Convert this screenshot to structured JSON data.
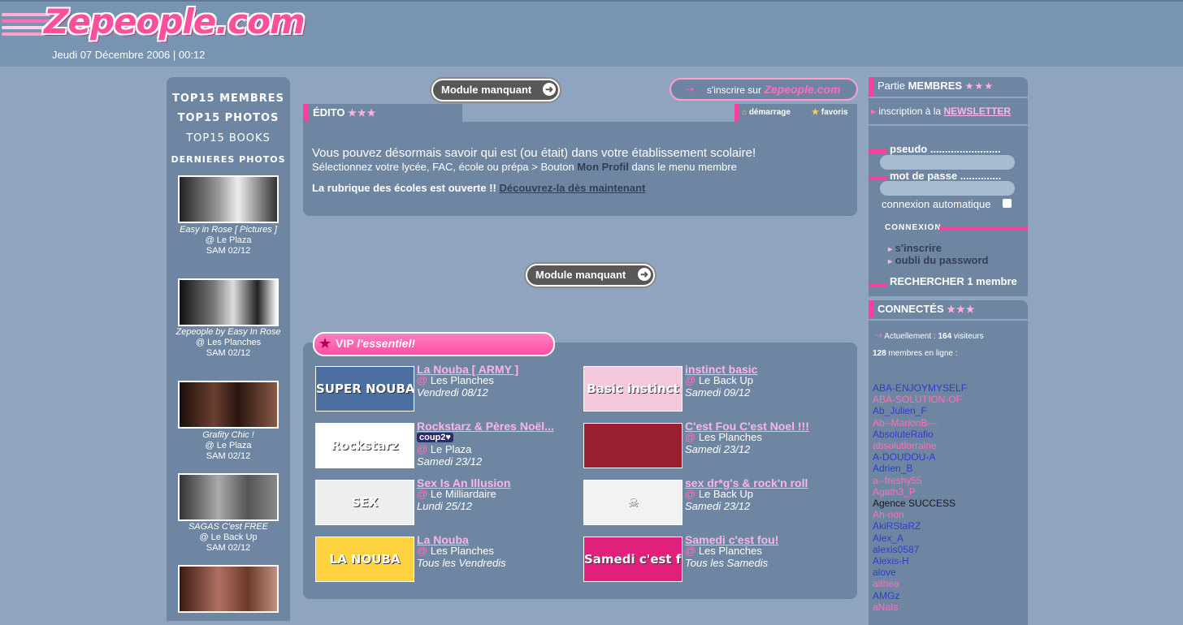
{
  "site": {
    "logo": "Zepeople.com",
    "date": "Jeudi 07 Décembre 2006 | 00:12"
  },
  "left_nav": {
    "top15_members": "TOP15 MEMBRES",
    "top15_photos": "TOP15 PHOTOS",
    "top15_books": "TOP15 BOOKS",
    "last_photos": "DERNIERES PHOTOS",
    "photos": [
      {
        "title": "Easy in Rose [ Pictures ]",
        "place": "@ Le Plaza",
        "date": "SAM 02/12"
      },
      {
        "title": "Zepeople by Easy In Rose",
        "place": "@ Les Planches",
        "date": "SAM 02/12"
      },
      {
        "title": "Grafity Chic !",
        "place": "@ Le Plaza",
        "date": "SAM 02/12"
      },
      {
        "title": "SAGAS C'est FREE",
        "place": "@ Le Back Up",
        "date": "SAM 02/12"
      }
    ]
  },
  "center": {
    "module_missing": "Module manquant",
    "inscrire_prefix": "s'inscrire sur",
    "inscrire_brand": "Zepeople.com",
    "edito_title": "ÉDITO",
    "stars": "★★★",
    "demarrage": "démarrage",
    "favoris": "favoris",
    "edito_line1": "Vous pouvez désormais savoir qui est (ou était) dans votre établissement scolaire!",
    "edito_line2_a": "Sélectionnez votre lycée, FAC, école ou prépa > Bouton",
    "edito_line2_b": "Mon Profil",
    "edito_line2_c": "dans le menu membre",
    "edito_line3_a": "La rubrique des écoles est ouverte !!",
    "edito_line3_b": "Découvrez-la dès maintenant",
    "vip_label": "VIP",
    "vip_tagline": "l'essentiel!",
    "events": [
      {
        "title": "La Nouba [ ARMY ]",
        "extra": "",
        "place": "Les Planches",
        "date": "Vendredi 08/12",
        "img_text": "SUPER NOUBA",
        "img_bg": "#4b6fa0"
      },
      {
        "title": "instinct basic",
        "extra": "",
        "place": "Le Back Up",
        "date": "Samedi 09/12",
        "img_text": "Basic instinct",
        "img_bg": "#f3c8dd"
      },
      {
        "title": "Rockstarz & Pères Noël...",
        "extra": "coup2♥",
        "place": "Le Plaza",
        "date": "Samedi 23/12",
        "img_text": "Rockstarz",
        "img_bg": "#ffffff"
      },
      {
        "title": "C'est Fou C'est Noel !!!",
        "extra": "",
        "place": "Les Planches",
        "date": "Samedi 23/12",
        "img_text": "",
        "img_bg": "#9a2030"
      },
      {
        "title": "Sex Is An Illusion",
        "extra": "",
        "place": "Le Milliardaire",
        "date": "Lundi 25/12",
        "img_text": "SEX",
        "img_bg": "#eeeeee"
      },
      {
        "title": "sex dr*g's & rock'n roll",
        "extra": "",
        "place": "Le Back Up",
        "date": "Samedi 23/12",
        "img_text": "☠",
        "img_bg": "#f2f2f2"
      },
      {
        "title": "La Nouba",
        "extra": "",
        "place": "Les Planches",
        "date": "Tous les Vendredis",
        "img_text": "LA NOUBA",
        "img_bg": "#ffd23f"
      },
      {
        "title": "Samedi c'est fou!",
        "extra": "",
        "place": "Les Planches",
        "date": "Tous les Samedis",
        "img_text": "Samedi c'est fou !",
        "img_bg": "#e0207a"
      }
    ]
  },
  "right_panel": {
    "partie_prefix": "Partie",
    "partie_bold": "MEMBRES",
    "newsletter_prefix": "inscription à la",
    "newsletter_link": "NEWSLETTER",
    "pseudo_label": "pseudo ........................",
    "password_label": "mot de passe ..............",
    "auto_login": "connexion automatique",
    "connexion": "CONNEXION",
    "register": "s'inscrire",
    "forgot": "oubli du password",
    "search_member": "RECHERCHER 1 membre",
    "connected_title": "CONNECTÉS",
    "visitors_prefix": "Actuellement :",
    "visitors_count": "164",
    "visitors_suffix": "visiteurs",
    "online_count": "128",
    "online_suffix": "membres en ligne :",
    "members": [
      {
        "name": "ABA-ENJOYMYSELF",
        "color": "#2a3fcf"
      },
      {
        "name": "ABA-SOLUTION-OF",
        "color": "#ff6fb7"
      },
      {
        "name": "Ab_Julien_F",
        "color": "#2a3fcf"
      },
      {
        "name": "Ab--MarionB---",
        "color": "#ff6fb7"
      },
      {
        "name": "AbsoluteRafio",
        "color": "#2a3fcf"
      },
      {
        "name": "absolutlorraine",
        "color": "#ff6fb7"
      },
      {
        "name": "A-DOUDOU-A",
        "color": "#2a3fcf"
      },
      {
        "name": "Adrien_B",
        "color": "#2a3fcf"
      },
      {
        "name": "a--freshy55",
        "color": "#ff6fb7"
      },
      {
        "name": "Agath3_P",
        "color": "#ff6fb7"
      },
      {
        "name": "Agence SUCCESS",
        "color": "#1a1a1a"
      },
      {
        "name": "Ah-non",
        "color": "#ff6fb7"
      },
      {
        "name": "AkiRStaRZ",
        "color": "#2a3fcf"
      },
      {
        "name": "Alex_A",
        "color": "#2a3fcf"
      },
      {
        "name": "alexis0587",
        "color": "#2a3fcf"
      },
      {
        "name": "Alexis-H",
        "color": "#2a3fcf"
      },
      {
        "name": "alove",
        "color": "#2a3fcf"
      },
      {
        "name": "althea",
        "color": "#ff6fb7"
      },
      {
        "name": "AMGz",
        "color": "#2a3fcf"
      },
      {
        "name": "aNaIs",
        "color": "#ff6fb7"
      }
    ]
  }
}
